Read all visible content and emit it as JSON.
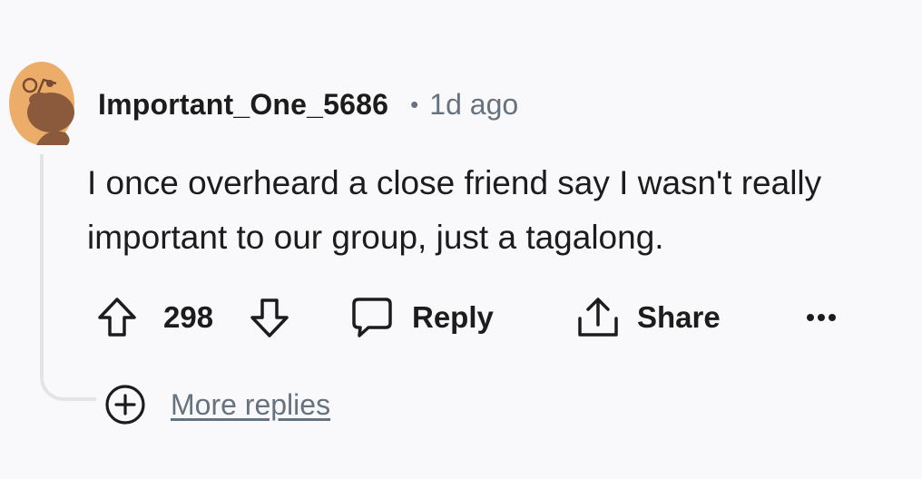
{
  "comment": {
    "author": "Important_One_5686",
    "separator": "•",
    "time": "1d ago",
    "body": "I once overheard a close friend say I wasn't really important to our group, just a tagalong.",
    "votes": "298",
    "reply_label": "Reply",
    "share_label": "Share",
    "more_glyph": "•••",
    "more_replies_label": "More replies"
  },
  "icons": {
    "avatar": "snoo-avatar",
    "upvote": "arrow-up-outline-icon",
    "downvote": "arrow-down-outline-icon",
    "reply": "speech-bubble-icon",
    "share": "share-upload-icon",
    "overflow": "ellipsis-icon",
    "expand": "plus-circle-icon"
  },
  "colors": {
    "background": "#f9f9fb",
    "text": "#1c1c1c",
    "muted": "#66727d",
    "thread_line": "#e2e4e7",
    "avatar_bg": "#edad6a",
    "avatar_fg": "#8b5a3c"
  }
}
